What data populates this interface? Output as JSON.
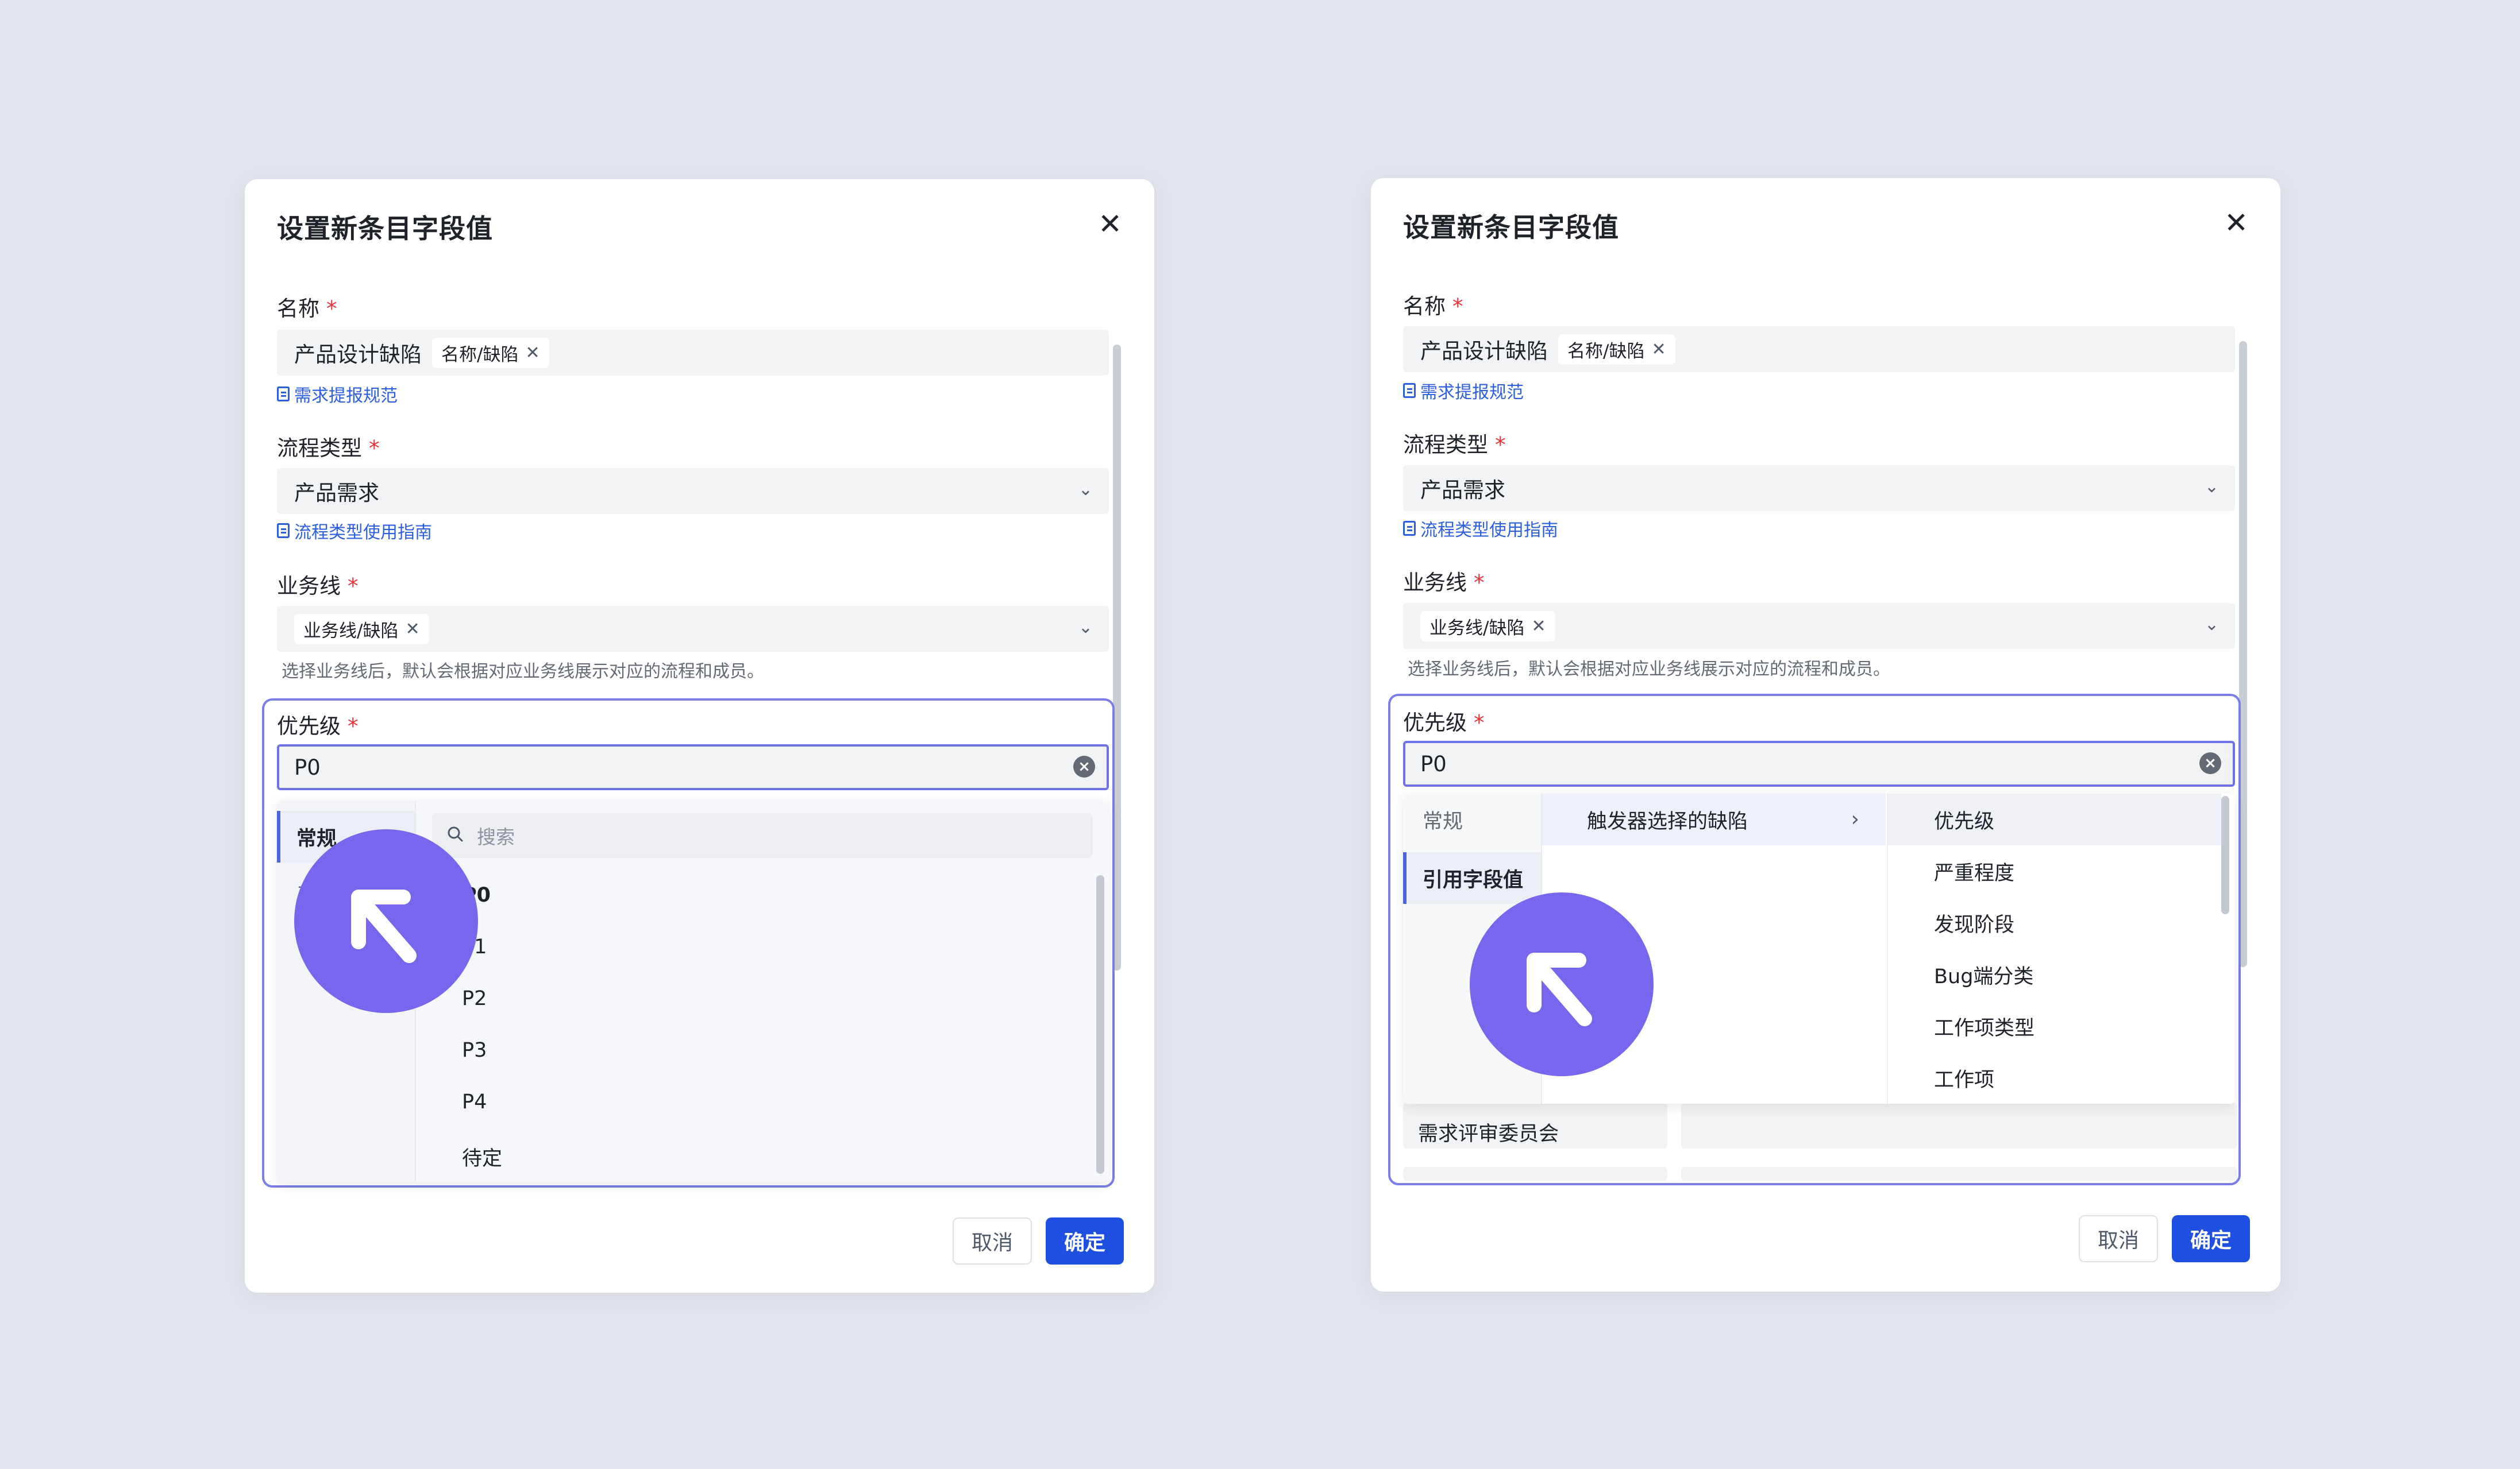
{
  "dialog_left": {
    "title": "设置新条目字段值",
    "name_label": "名称",
    "name_value": "产品设计缺陷",
    "name_chip": "名称/缺陷",
    "name_link": "需求提报规范",
    "flow_label": "流程类型",
    "flow_value": "产品需求",
    "flow_link": "流程类型使用指南",
    "biz_label": "业务线",
    "biz_chip": "业务线/缺陷",
    "biz_hint": "选择业务线后，默认会根据对应业务线展示对应的流程和成员。",
    "priority_label": "优先级",
    "priority_value": "P0",
    "dropdown": {
      "tabs": [
        "常规",
        "引"
      ],
      "search_placeholder": "搜索",
      "options": [
        "P0",
        "P1",
        "P2",
        "P3",
        "P4",
        "待定"
      ]
    },
    "cancel_label": "取消",
    "ok_label": "确定"
  },
  "dialog_right": {
    "title": "设置新条目字段值",
    "name_label": "名称",
    "name_value": "产品设计缺陷",
    "name_chip": "名称/缺陷",
    "name_link": "需求提报规范",
    "flow_label": "流程类型",
    "flow_value": "产品需求",
    "flow_link": "流程类型使用指南",
    "biz_label": "业务线",
    "biz_chip": "业务线/缺陷",
    "biz_hint": "选择业务线后，默认会根据对应业务线展示对应的流程和成员。",
    "priority_label": "优先级",
    "priority_value": "P0",
    "dropdown": {
      "tabs": [
        "常规",
        "引用字段值"
      ],
      "source_item": "触发器选择的缺陷",
      "fields": [
        "优先级",
        "严重程度",
        "发现阶段",
        "Bug端分类",
        "工作项类型",
        "工作项"
      ]
    },
    "behind_row_label": "需求评审委员会",
    "cancel_label": "取消",
    "ok_label": "确定"
  },
  "icons": {
    "close": "close-icon",
    "required": "required-asterisk",
    "doc": "doc-icon",
    "chevron": "chevron-down-icon",
    "clear": "clear-icon",
    "search": "search-icon",
    "arrow": "chevron-right-icon",
    "cursor": "cursor-pointer-icon"
  },
  "colors": {
    "accent": "#1f4fe0",
    "focus": "#7a7fe8",
    "cursor_badge": "#7766ee",
    "required": "#e5363c",
    "link": "#2b5fe0"
  }
}
